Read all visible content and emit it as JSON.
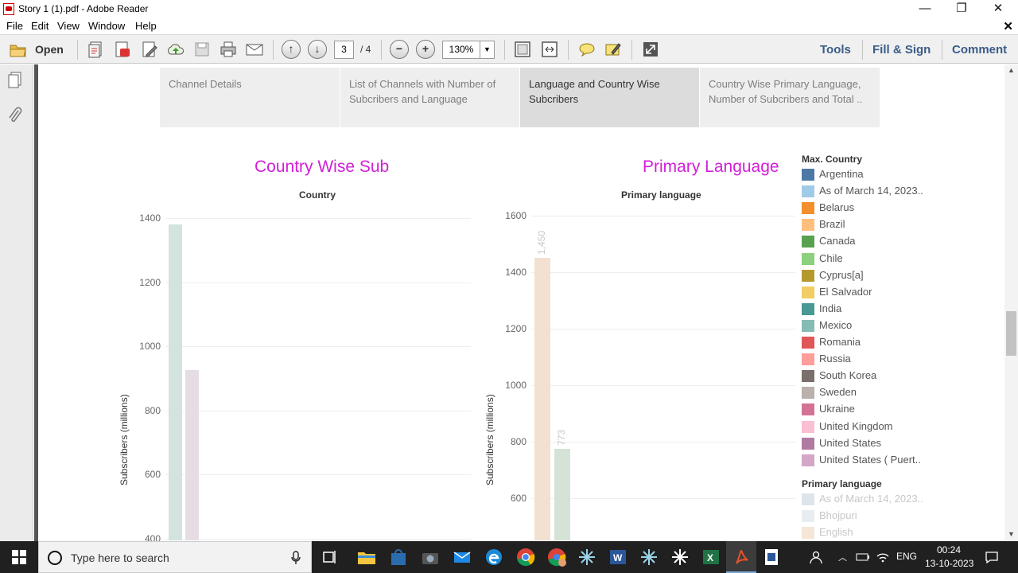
{
  "window": {
    "title": "Story 1 (1).pdf - Adobe Reader",
    "minimize": "—",
    "restore": "❐",
    "close": "✕"
  },
  "menu": [
    "File",
    "Edit",
    "View",
    "Window",
    "Help"
  ],
  "toolbar": {
    "open_label": "Open",
    "page_current": "3",
    "page_total": "/ 4",
    "zoom": "130%",
    "tools": "Tools",
    "fill_sign": "Fill & Sign",
    "comment": "Comment"
  },
  "story_tabs": [
    "Channel Details",
    "List of Channels with Number of Subcribers and Language",
    "Language and Country Wise Subcribers",
    "Country Wise Primary Language, Number of Subcribers and Total .."
  ],
  "active_tab": 2,
  "chart_data": [
    {
      "type": "bar",
      "title": "Country Wise Sub",
      "subtitle": "Country",
      "ylabel": "Subscribers (millions)",
      "yticks": [
        "1400",
        "1200",
        "1000",
        "800",
        "600",
        "400"
      ],
      "ylim": [
        400,
        1420
      ],
      "values": [
        1380,
        925
      ],
      "colors": [
        "#d3e3df",
        "#e6dde4"
      ]
    },
    {
      "type": "bar",
      "title": "Primary Language",
      "subtitle": "Primary language",
      "ylabel": "Subscribers (millions)",
      "yticks": [
        "1600",
        "1400",
        "1200",
        "1000",
        "800",
        "600"
      ],
      "ylim": [
        500,
        1620
      ],
      "values": [
        1450,
        773
      ],
      "data_labels": [
        "1,450",
        "773"
      ],
      "colors": [
        "#f2e1d0",
        "#d5e3d6"
      ]
    }
  ],
  "legend_country": {
    "title": "Max. Country",
    "items": [
      {
        "label": "Argentina",
        "color": "#4e79a7"
      },
      {
        "label": "As of March 14, 2023..",
        "color": "#a0cbe8"
      },
      {
        "label": "Belarus",
        "color": "#f28e2b"
      },
      {
        "label": "Brazil",
        "color": "#ffbe7d"
      },
      {
        "label": "Canada",
        "color": "#59a14f"
      },
      {
        "label": "Chile",
        "color": "#8cd17d"
      },
      {
        "label": "Cyprus[a]",
        "color": "#b6992d"
      },
      {
        "label": "El Salvador",
        "color": "#f1ce63"
      },
      {
        "label": "India",
        "color": "#499894"
      },
      {
        "label": "Mexico",
        "color": "#86bcb6"
      },
      {
        "label": "Romania",
        "color": "#e15759"
      },
      {
        "label": "Russia",
        "color": "#ff9d9a"
      },
      {
        "label": "South Korea",
        "color": "#79706e"
      },
      {
        "label": "Sweden",
        "color": "#bab0ac"
      },
      {
        "label": "Ukraine",
        "color": "#d37295"
      },
      {
        "label": "United Kingdom",
        "color": "#fabfd2"
      },
      {
        "label": "United States",
        "color": "#b07aa1"
      },
      {
        "label": "United States ( Puert..",
        "color": "#d4a6c8"
      }
    ]
  },
  "legend_language": {
    "title": "Primary language",
    "items": [
      {
        "label": "As of March 14, 2023..",
        "color": "#dde4ea"
      },
      {
        "label": "Bhojpuri",
        "color": "#e8edf2"
      },
      {
        "label": "English",
        "color": "#f5e6d8"
      }
    ]
  },
  "taskbar": {
    "search_placeholder": "Type here to search",
    "time": "00:24",
    "date": "13-10-2023",
    "lang": "ENG"
  }
}
